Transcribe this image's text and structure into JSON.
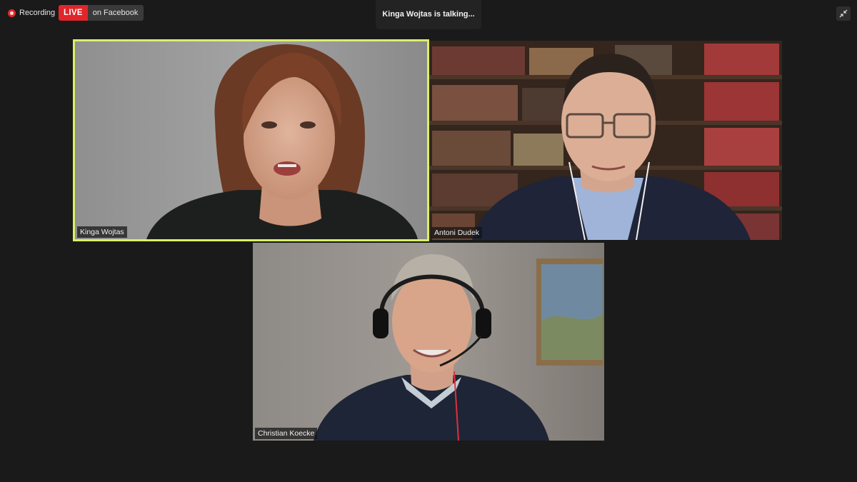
{
  "status_bar": {
    "recording_label": "Recording",
    "live_label": "LIVE",
    "live_destination": "on Facebook"
  },
  "talking_indicator": "Kinga Wojtas is talking...",
  "participants": [
    {
      "name": "Kinga Wojtas",
      "active_speaker": true
    },
    {
      "name": "Antoni Dudek",
      "active_speaker": false
    },
    {
      "name": "Christian Koecke",
      "active_speaker": false
    }
  ],
  "icons": {
    "recording": "recording-dot-icon",
    "exit_fullscreen": "exit-fullscreen-icon"
  },
  "colors": {
    "background": "#1a1a1a",
    "live_red": "#e0252b",
    "active_speaker_border": "#d9ef6a"
  }
}
